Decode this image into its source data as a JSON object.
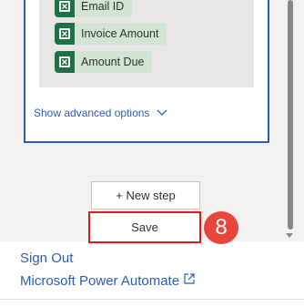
{
  "card": {
    "tokens": [
      {
        "label": "Email ID",
        "icon": "excel-icon"
      },
      {
        "label": "Invoice Amount",
        "icon": "excel-icon"
      },
      {
        "label": "Amount Due",
        "icon": "excel-icon"
      }
    ],
    "advanced_options_label": "Show advanced options"
  },
  "actions": {
    "new_step_label": "+ New step",
    "save_label": "Save",
    "step_marker": "8"
  },
  "footer": {
    "sign_out_label": "Sign Out",
    "power_automate_label": "Microsoft Power Automate"
  },
  "colors": {
    "accent": "#2b5fb4",
    "highlight": "#e0191b",
    "marker": "#e8453c",
    "excel_green": "#1f7145"
  }
}
